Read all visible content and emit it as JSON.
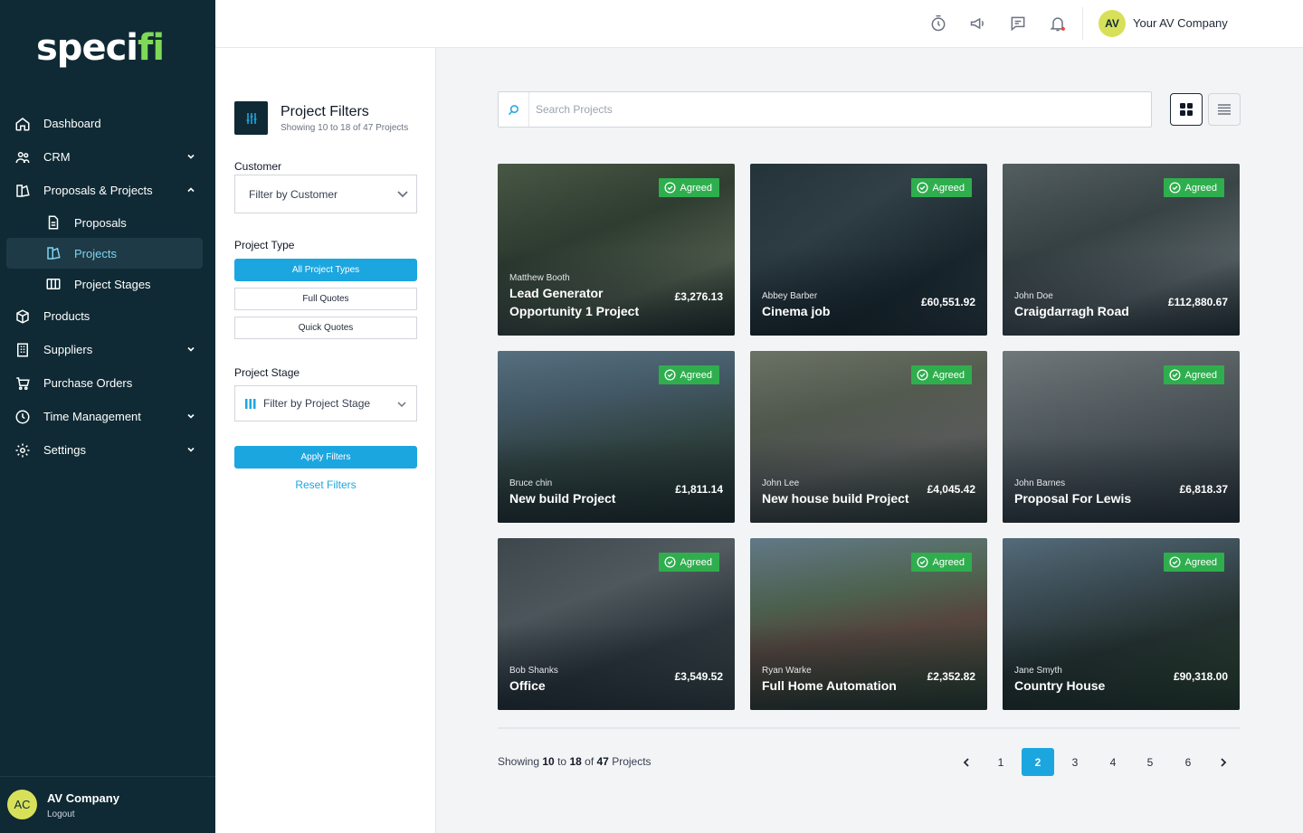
{
  "brand": {
    "logo_main": "speci",
    "logo_dot": "fi"
  },
  "sidebar": {
    "items": [
      {
        "label": "Dashboard"
      },
      {
        "label": "CRM"
      },
      {
        "label": "Proposals & Projects"
      },
      {
        "label": "Proposals"
      },
      {
        "label": "Projects"
      },
      {
        "label": "Project Stages"
      },
      {
        "label": "Products"
      },
      {
        "label": "Suppliers"
      },
      {
        "label": "Purchase Orders"
      },
      {
        "label": "Time Management"
      },
      {
        "label": "Settings"
      }
    ],
    "footer": {
      "initials": "AC",
      "name": "AV Company",
      "logout": "Logout"
    }
  },
  "topbar": {
    "initials": "AV",
    "company": "Your AV Company"
  },
  "filters": {
    "title": "Project Filters",
    "subtitle": "Showing 10 to 18 of 47 Projects",
    "customer_label": "Customer",
    "customer_placeholder": "Filter by Customer",
    "type_label": "Project Type",
    "types": [
      "All Project Types",
      "Full Quotes",
      "Quick Quotes"
    ],
    "stage_label": "Project Stage",
    "stage_placeholder": "Filter by Project Stage",
    "apply": "Apply Filters",
    "reset": "Reset Filters"
  },
  "search": {
    "placeholder": "Search Projects"
  },
  "projects": [
    {
      "customer": "Matthew Booth",
      "title": "Lead Generator Opportunity 1 Project",
      "price": "£3,276.13",
      "status": "Agreed"
    },
    {
      "customer": "Abbey Barber",
      "title": "Cinema job",
      "price": "£60,551.92",
      "status": "Agreed"
    },
    {
      "customer": "John Doe",
      "title": "Craigdarragh Road",
      "price": "£112,880.67",
      "status": "Agreed"
    },
    {
      "customer": "Bruce chin",
      "title": "New build Project",
      "price": "£1,811.14",
      "status": "Agreed"
    },
    {
      "customer": "John Lee",
      "title": "New house build Project",
      "price": "£4,045.42",
      "status": "Agreed"
    },
    {
      "customer": "John Barnes",
      "title": "Proposal For Lewis",
      "price": "£6,818.37",
      "status": "Agreed"
    },
    {
      "customer": "Bob Shanks",
      "title": "Office",
      "price": "£3,549.52",
      "status": "Agreed"
    },
    {
      "customer": "Ryan Warke",
      "title": "Full Home Automation",
      "price": "£2,352.82",
      "status": "Agreed"
    },
    {
      "customer": "Jane Smyth",
      "title": "Country House",
      "price": "£90,318.00",
      "status": "Agreed"
    }
  ],
  "pagination": {
    "showing_prefix": "Showing",
    "from": "10",
    "to_word": "to",
    "to": "18",
    "of_word": "of",
    "total": "47",
    "suffix": "Projects",
    "pages": [
      "1",
      "2",
      "3",
      "4",
      "5",
      "6"
    ],
    "current": "2"
  },
  "colors": {
    "sidebar": "#0f2a34",
    "accent": "#1ca6e0",
    "badge": "#2fae4e",
    "avatar": "#d8e05a"
  }
}
